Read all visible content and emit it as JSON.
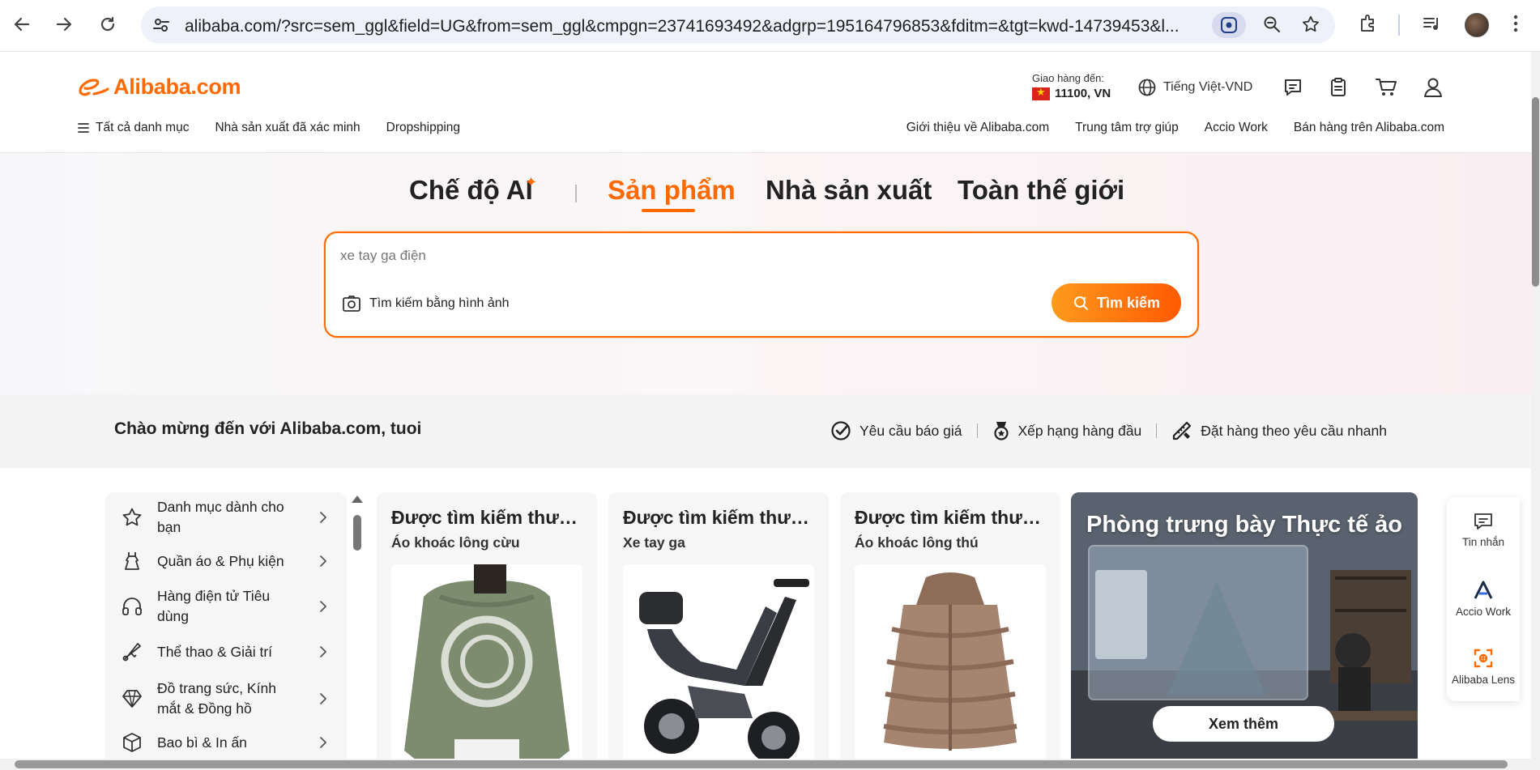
{
  "browser": {
    "url": "alibaba.com/?src=sem_ggl&field=UG&from=sem_ggl&cmpgn=23741693492&adgrp=195164796853&fditm=&tgt=kwd-14739453&l..."
  },
  "site": {
    "logo_text": "Alibaba.com",
    "brand_color": "#ff6a00",
    "shipping": {
      "label": "Giao hàng đến:",
      "value": "11100, VN"
    },
    "language": "Tiếng Việt-VND"
  },
  "subnav": {
    "all_categories": "Tất cả danh mục",
    "verified": "Nhà sản xuất đã xác minh",
    "dropshipping": "Dropshipping",
    "about": "Giới thiệu về Alibaba.com",
    "help": "Trung tâm trợ giúp",
    "accio": "Accio Work",
    "sell": "Bán hàng trên Alibaba.com"
  },
  "hero": {
    "tabs": [
      "Chế độ AI",
      "Sản phẩm",
      "Nhà sản xuất",
      "Toàn thế giới"
    ],
    "active_tab": "Sản phẩm",
    "search_placeholder": "xe tay ga điện",
    "image_search": "Tìm kiếm bằng hình ảnh",
    "search_button": "Tìm kiếm"
  },
  "welcome": {
    "text": "Chào mừng đến với Alibaba.com, tuoi",
    "links": [
      "Yêu cầu báo giá",
      "Xếp hạng hàng đầu",
      "Đặt hàng theo yêu cầu nhanh"
    ]
  },
  "categories": [
    {
      "label": "Danh mục dành cho bạn",
      "icon": "star-icon"
    },
    {
      "label": "Quần áo & Phụ kiện",
      "icon": "dress-icon"
    },
    {
      "label": "Hàng điện tử Tiêu dùng",
      "icon": "headphones-icon"
    },
    {
      "label": "Thể thao & Giải trí",
      "icon": "shuttlecock-icon"
    },
    {
      "label": "Đồ trang sức, Kính mắt & Đồng hồ",
      "icon": "diamond-icon"
    },
    {
      "label": "Bao bì & In ấn",
      "icon": "box-icon"
    }
  ],
  "cards": [
    {
      "title": "Được tìm kiếm thường xuyên",
      "subtitle": "Áo khoác lông cừu"
    },
    {
      "title": "Được tìm kiếm thường xuyên",
      "subtitle": "Xe tay ga"
    },
    {
      "title": "Được tìm kiếm thường xuyên",
      "subtitle": "Áo khoác lông thú"
    }
  ],
  "banner": {
    "title": "Phòng trưng bày Thực tế ảo",
    "button": "Xem thêm"
  },
  "rail": {
    "messages": "Tin nhắn",
    "accio": "Accio Work",
    "lens": "Alibaba Lens"
  }
}
